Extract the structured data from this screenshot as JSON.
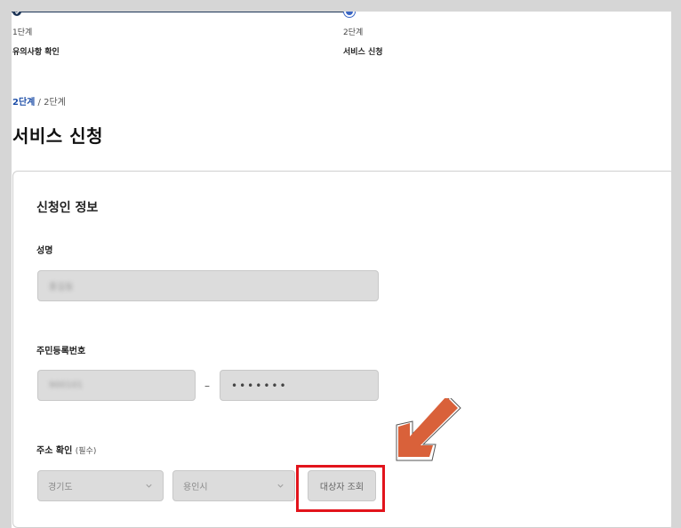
{
  "stepper": {
    "steps": [
      {
        "number": "1단계",
        "title": "유의사항 확인",
        "status": "done"
      },
      {
        "number": "2단계",
        "title": "서비스 신청",
        "status": "current"
      }
    ]
  },
  "breadcrumb": {
    "current": "2단계",
    "separator": " / ",
    "total": "2단계"
  },
  "page_title": "서비스 신청",
  "form": {
    "section_title": "신청인 정보",
    "name": {
      "label": "성명",
      "value": "홍길동"
    },
    "resident_number": {
      "label": "주민등록번호",
      "front": "900101",
      "dash": "–",
      "back": "•••••••"
    },
    "address": {
      "label": "주소 확인",
      "hint": "(필수)",
      "province": "경기도",
      "city": "용인시",
      "lookup_button": "대상자 조회"
    }
  },
  "colors": {
    "accent": "#1f4fa8",
    "stepper": "#1d3557",
    "highlight": "#e2141c",
    "arrow": "#d9613a"
  },
  "icons": [
    "check-icon",
    "chevron-down-icon",
    "pointer-arrow-icon"
  ]
}
